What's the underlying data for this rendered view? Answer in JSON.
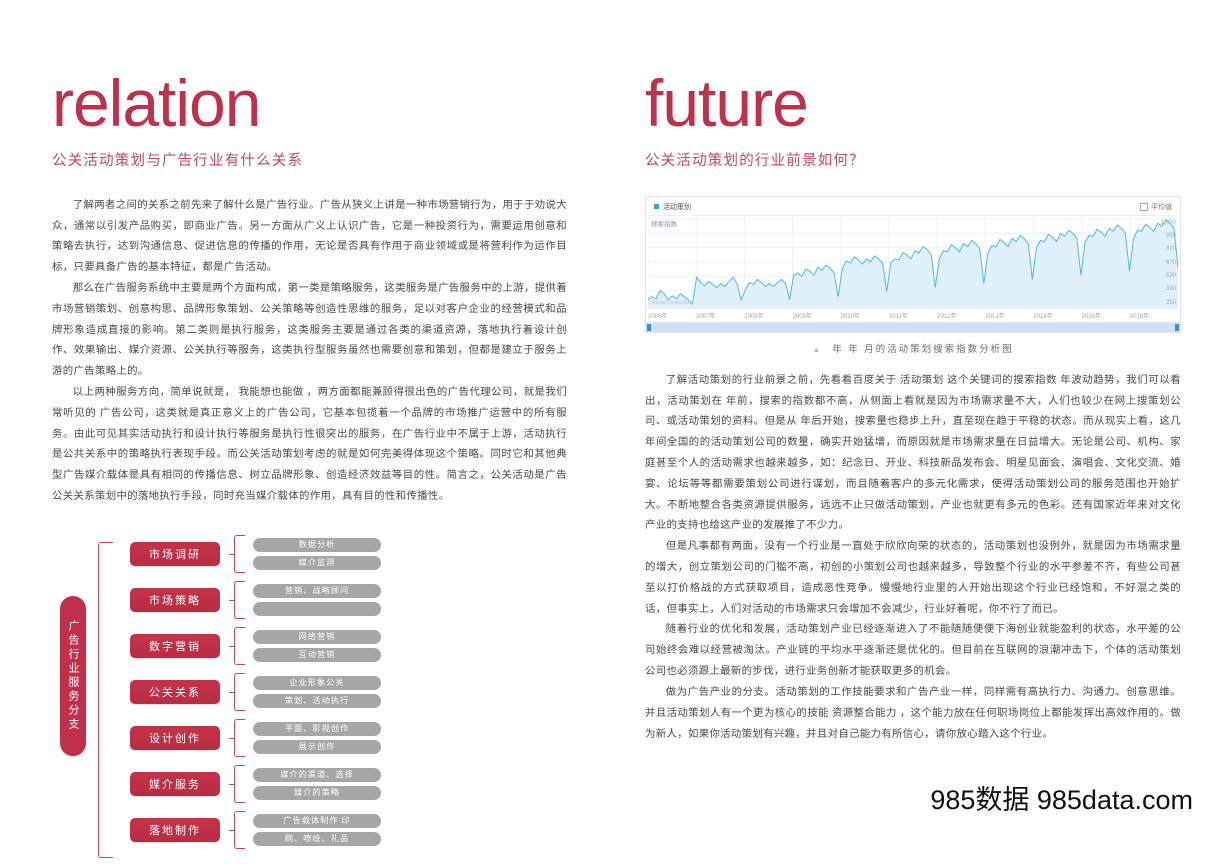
{
  "left": {
    "big_title": "relation",
    "subtitle": "公关活动策划与广告行业有什么关系",
    "paragraphs": [
      "了解两者之间的关系之前先来了解什么是广告行业。广告从狭义上讲是一种市场营销行为，用于于劝说大众，通常以引发产品购买，即商业广告。另一方面从广义上认识广告，它是一种投资行为，需要运用创意和策略去执行，达到沟通信息、促进信息的传播的作用，无论是否具有作用于商业领域或是将营利作为运作目标，只要具备广告的基本特征，都是广告活动。",
      "那么在广告服务系统中主要是两个方面构成，第一类是策略服务，这类服务是广告服务中的上游，提供着市场营销策划、创意构思、品牌形象策划、公关策略等创造性思维的服务，足以对客户企业的经营模式和品牌形象造成直接的影响。第二类则是执行服务，这类服务主要是通过各类的渠道资源，落地执行着设计创作、效果输出、媒介资源、公关执行等服务，这类执行型服务虽然也需要创意和策划，但都是建立于服务上游的广告策略上的。",
      "以上两种服务方向，简单说就是， 我能想也能做 ，两方面都能兼顾得很出色的广告代理公司，就是我们常听见的 广告公司，这类就是真正意义上的广告公司，它基本包揽着一个品牌的市场推广运营中的所有服务。由此可见其实活动执行和设计执行等服务是执行性很突出的服务，在广告行业中不属于上游，活动执行是公共关系中的策略执行表现手段。而公关活动策划考虑的就是如何完美得体现这个策略。同时它和其他典型广告媒介载体是具有相同的传播信息、树立品牌形象、创造经济效益等目的性。简言之，公关活动是广告公关关系策划中的落地执行手段，同时充当媒介载体的作用，具有目的性和传播性。"
    ],
    "diagram": {
      "vertical_label": "广告行业服务分支",
      "rows": [
        {
          "category": "市场调研",
          "items": [
            "数据分析",
            "媒介监测"
          ]
        },
        {
          "category": "市场策略",
          "items": [
            "营销、战略顾问",
            ""
          ]
        },
        {
          "category": "数字营销",
          "items": [
            "网络营销",
            "互动营销"
          ]
        },
        {
          "category": "公关关系",
          "items": [
            "企业形象公关",
            "策划、活动执行"
          ]
        },
        {
          "category": "设计创作",
          "items": [
            "平面、影视创作",
            "展示创作"
          ]
        },
        {
          "category": "媒介服务",
          "items": [
            "媒介的渠道、选择",
            "媒介的策略"
          ]
        },
        {
          "category": "落地制作",
          "items": [
            "广告载体制作 印",
            "刷、喷绘、礼品"
          ]
        }
      ]
    }
  },
  "right": {
    "big_title": "future",
    "subtitle": "公关活动策划的行业前景如何？",
    "chart_caption_triangle": "▲",
    "chart_caption": "年        年 月的活动策划搜索指数分析图",
    "paragraphs": [
      "了解活动策划的行业前景之前，先看看百度关于 活动策划 这个关键词的搜索指数  年波动趋势，我们可以看出，活动策划在      年前，搜索的指数都不高，从侧面上看就是因为市场需求量不大，人们也较少在网上搜策划公司、或活动策划的资料。但是从      年后开始，搜索量也稳步上升，直至现在趋于平稳的状态。而从现实上看，这几年间全国的的活动策划公司的数量，确实开始猛增，而原因就是市场需求量在日益增大。无论是公司、机构、家庭甚至个人的活动需求也越来越多，如：纪念日、开业、科技新品发布会、明星见面会、演唱会、文化交流、婚宴、论坛等等都需要策划公司进行谋划，而且随着客户的多元化需求，使得活动策划公司的服务范围也开始扩大。不断地整合各类资源提供服务，远远不止只做活动策划，产业也就更有多元的色彩。还有国家近年来对文化产业的支持也给这产业的发展推了不少力。",
      "但是凡事都有两面，没有一个行业是一直处于欣欣向荣的状态的，活动策划也没例外，就是因为市场需求量的增大，创立策划公司的门槛不高，初创的小策划公司也越来越多，导致整个行业的水平参差不齐，有些公司甚至以打价格战的方式获取项目，造成恶性竞争。慢慢地行业里的人开始出现这个行业已经饱和，不好混之类的话，但事实上，人们对活动的市场需求只会增加不会减少，行业好着呢，你不行了而已。",
      "随着行业的优化和发展，活动策划产业已经逐渐进入了不能随随便便下海创业就能盈利的状态，水平差的公司始终会难以经营被淘汰。产业链的平均水平逐渐还是优化的。但目前在互联网的浪潮冲击下，个体的活动策划公司也必须跟上最新的步伐，进行业务创新才能获取更多的机会。",
      "做为广告产业的分支。活动策划的工作技能要求和广告产业一样，同样需有高执行力、沟通力、创意思维。并且活动策划人有一个更为核心的技能  资源整合能力  ，这个能力放在任何职场岗位上都能发挥出高效作用的。做为新人，如果你活动策划有兴趣，并且对自己能力有所信心，请你放心踏入这个行业。"
    ]
  },
  "chart_data": {
    "type": "area",
    "title": "",
    "series_name": "活动策划",
    "ylabel": "搜索指数",
    "xlabel": "",
    "legend": [
      "活动策划"
    ],
    "legend_right": "平均值",
    "grid": true,
    "ylim": [
      250,
      1090
    ],
    "yticks": [
      1090,
      950,
      810,
      670,
      530,
      390,
      250
    ],
    "ytick_labels": [
      "1,090",
      "950",
      "810",
      "670",
      "530",
      "390",
      "250"
    ],
    "categories": [
      "2006年",
      "2007年",
      "2008年",
      "2009年",
      "2010年",
      "2011年",
      "2012年",
      "2013年",
      "2014年",
      "2015年",
      "2016年"
    ],
    "line_color": "#4fb6e8",
    "fill_color": "#dff0fb",
    "watermark": "©index.baidu.com",
    "values": [
      300,
      330,
      310,
      390,
      360,
      300,
      340,
      310,
      360,
      330,
      300,
      260,
      520,
      470,
      440,
      480,
      450,
      420,
      460,
      430,
      480,
      520,
      460,
      300,
      390,
      470,
      450,
      500,
      470,
      430,
      460,
      430,
      470,
      500,
      460,
      300,
      540,
      560,
      530,
      600,
      580,
      540,
      620,
      590,
      640,
      610,
      560,
      330,
      600,
      680,
      660,
      720,
      690,
      650,
      700,
      670,
      730,
      700,
      660,
      380,
      660,
      700,
      690,
      760,
      740,
      700,
      780,
      760,
      820,
      790,
      740,
      420,
      700,
      780,
      770,
      840,
      810,
      770,
      850,
      820,
      880,
      850,
      800,
      460,
      760,
      830,
      820,
      890,
      860,
      820,
      900,
      870,
      930,
      900,
      850,
      500,
      810,
      880,
      870,
      940,
      910,
      870,
      950,
      920,
      980,
      950,
      900,
      540,
      860,
      930,
      920,
      990,
      960,
      920,
      1000,
      970,
      1030,
      1000,
      950,
      580,
      900,
      980,
      970,
      1040,
      1010,
      970,
      1050,
      1020,
      1080,
      1050,
      1000,
      620
    ]
  },
  "watermark": "985数据 985data.com"
}
